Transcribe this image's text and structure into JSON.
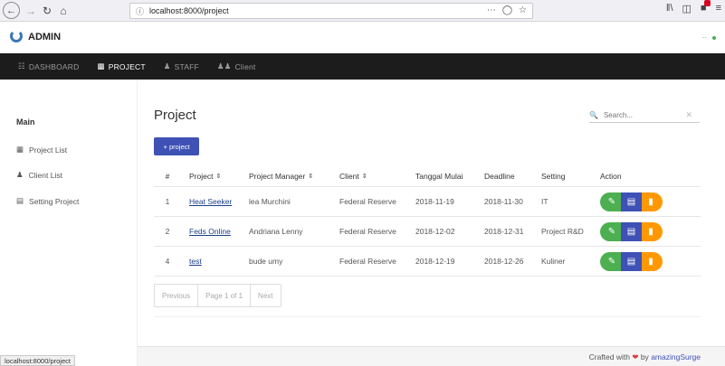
{
  "browser": {
    "url": "localhost:8000/project",
    "status_url": "localhost:8000/project"
  },
  "header": {
    "brand": "ADMIN",
    "user_menu": "··"
  },
  "top_nav": [
    {
      "icon": "dashboard-icon",
      "label": "DASHBOARD"
    },
    {
      "icon": "briefcase-icon",
      "label": "PROJECT"
    },
    {
      "icon": "person-icon",
      "label": "STAFF"
    },
    {
      "icon": "group-icon",
      "label": "Client"
    }
  ],
  "sidebar": {
    "title": "Main",
    "items": [
      {
        "icon": "grid-icon",
        "label": "Project List"
      },
      {
        "icon": "group-icon",
        "label": "Client List"
      },
      {
        "icon": "settings-icon",
        "label": "Setting Project"
      }
    ]
  },
  "main": {
    "title": "Project",
    "search_placeholder": "Search...",
    "add_button": "+ project"
  },
  "table": {
    "headers": [
      "#",
      "Project",
      "Project Manager",
      "Client",
      "Tanggal Mulai",
      "Deadline",
      "Setting",
      "Action"
    ],
    "rows": [
      {
        "num": "1",
        "project": "Heat Seeker",
        "manager": "lea Murchini",
        "client": "Federal Reserve",
        "start": "2018-11-19",
        "deadline": "2018-11-30",
        "setting": "IT"
      },
      {
        "num": "2",
        "project": "Feds Online",
        "manager": "Andriana Lenny",
        "client": "Federal Reserve",
        "start": "2018-12-02",
        "deadline": "2018-12-31",
        "setting": "Project R&D"
      },
      {
        "num": "4",
        "project": "test",
        "manager": "bude umy",
        "client": "Federal Reserve",
        "start": "2018-12-19",
        "deadline": "2018-12-26",
        "setting": "Kuliner"
      }
    ]
  },
  "pagination": {
    "previous": "Previous",
    "page_info": "Page 1 of 1",
    "next": "Next"
  },
  "footer": {
    "prefix": "Crafted with",
    "by": "by",
    "author": "amazingSurge"
  },
  "colors": {
    "nav_bg": "#1c1c1c",
    "primary": "#3f51b5",
    "edit": "#4caf50",
    "delete": "#ff9800"
  }
}
